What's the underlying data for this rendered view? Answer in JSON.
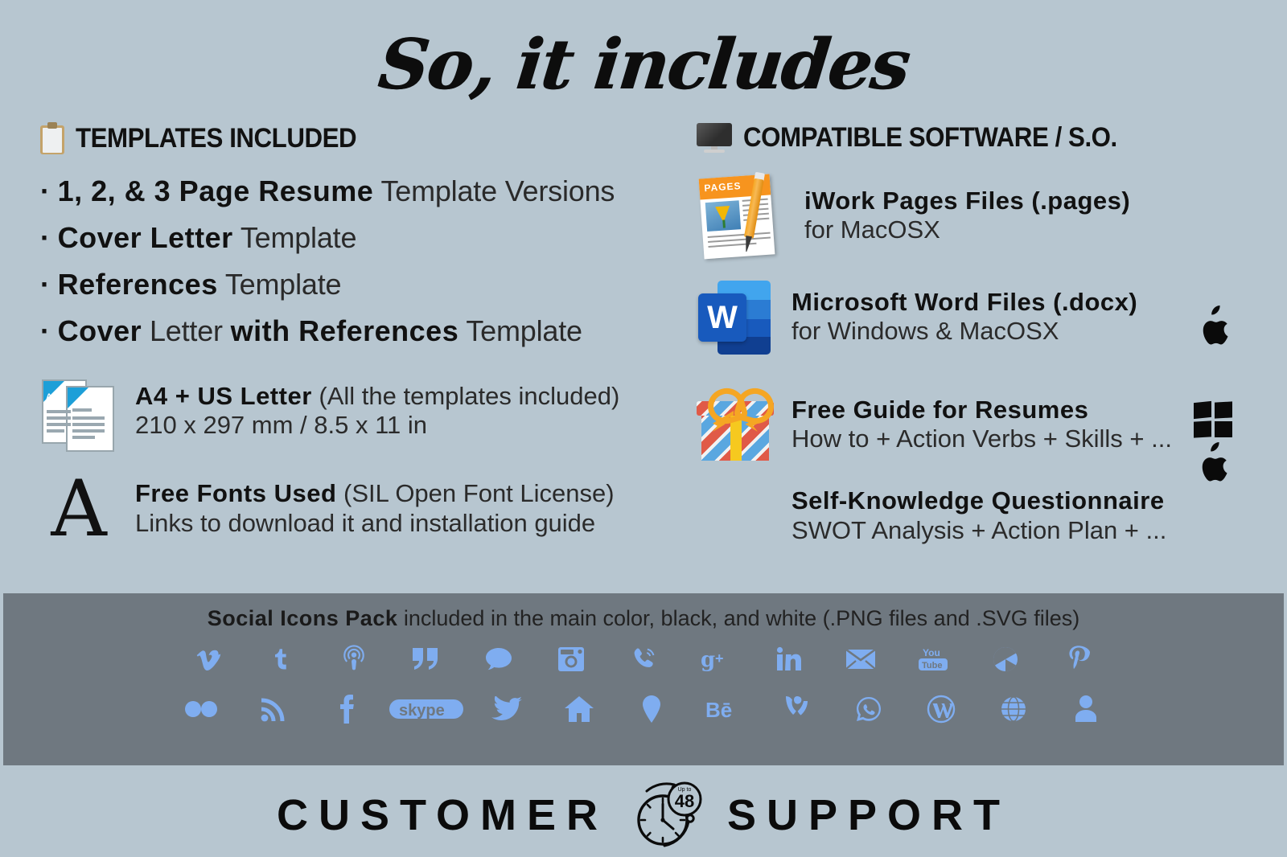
{
  "page": {
    "background_color": "#b7c6d0",
    "band_color": "#6f7880",
    "icon_color": "#7fadf0",
    "title": "So, it includes"
  },
  "left_column": {
    "heading": "TEMPLATES INCLUDED",
    "heading_icon": "clipboard-icon",
    "bullets": [
      {
        "bullet": "·",
        "bold1": "1, 2, & 3 Page Resume",
        "rest1": " Template Versions",
        "bold2": "",
        "rest2": ""
      },
      {
        "bullet": "·",
        "bold1": "Cover Letter",
        "rest1": " Template",
        "bold2": "",
        "rest2": ""
      },
      {
        "bullet": "·",
        "bold1": "References",
        "rest1": " Template",
        "bold2": "",
        "rest2": ""
      },
      {
        "bullet": "·",
        "bold1": "Cover",
        "rest1": " Letter ",
        "bold2": "with References",
        "rest2": " Template"
      }
    ],
    "features": [
      {
        "icon": "a4-documents-icon",
        "title_bold": "A4 + US Letter",
        "title_rest": " (All the templates included)",
        "subtitle": "210 x 297 mm / 8.5 x 11 in"
      },
      {
        "icon": "serif-letter-a-icon",
        "icon_glyph": "A",
        "title_bold": "Free Fonts Used",
        "title_rest": " (SIL Open Font License)",
        "subtitle": "Links to download it and installation guide"
      }
    ]
  },
  "right_column": {
    "heading": "COMPATIBLE SOFTWARE / S.O.",
    "heading_icon": "desktop-monitor-icon",
    "features": [
      {
        "icon": "iwork-pages-icon",
        "icon_label": "PAGES",
        "title": "iWork Pages Files (.pages)",
        "subtitle": "for MacOSX",
        "os_logos": [
          "apple-logo-icon"
        ]
      },
      {
        "icon": "microsoft-word-icon",
        "icon_letter": "W",
        "title": "Microsoft Word Files (.docx)",
        "subtitle": "for Windows & MacOSX",
        "os_logos": [
          "windows-logo-icon",
          "apple-logo-icon"
        ]
      },
      {
        "icon": "gift-box-icon",
        "title": "Free Guide for Resumes",
        "subtitle": "How to + Action Verbs + Skills + ...",
        "os_logos": []
      },
      {
        "icon": "",
        "title": "Self-Knowledge Questionnaire",
        "subtitle": "SWOT Analysis + Action Plan + ...",
        "os_logos": []
      }
    ]
  },
  "social_band": {
    "caption_bold": "Social Icons Pack",
    "caption_rest": " included in the main color, black, and white (.PNG files and .SVG files)",
    "row1": [
      "vimeo-icon",
      "tumblr-icon",
      "podcast-icon",
      "quote-icon",
      "chat-bubble-icon",
      "instagram-icon",
      "phone-icon",
      "google-plus-icon",
      "linkedin-icon",
      "email-icon",
      "youtube-icon",
      "aperture-icon",
      "pinterest-icon"
    ],
    "row2": [
      "flickr-icon",
      "rss-icon",
      "facebook-icon",
      "skype-icon",
      "twitter-icon",
      "home-icon",
      "map-pin-icon",
      "behance-icon",
      "vine-icon",
      "whatsapp-icon",
      "wordpress-icon",
      "globe-icon",
      "person-icon"
    ],
    "row1_labels": [
      "v",
      "t",
      "",
      "”",
      "",
      "",
      "",
      "g+",
      "in",
      "",
      "YouTube",
      "",
      "℗"
    ],
    "row2_labels": [
      "",
      "",
      "f",
      "skype",
      "",
      "",
      "",
      "Bē",
      "",
      "",
      "W",
      "",
      ""
    ]
  },
  "footer": {
    "word_left": "CUSTOMER",
    "word_right": "SUPPORT",
    "clock_badge_small": "Up to",
    "clock_badge_number": "48",
    "clock_icon": "clock-48h-icon"
  }
}
